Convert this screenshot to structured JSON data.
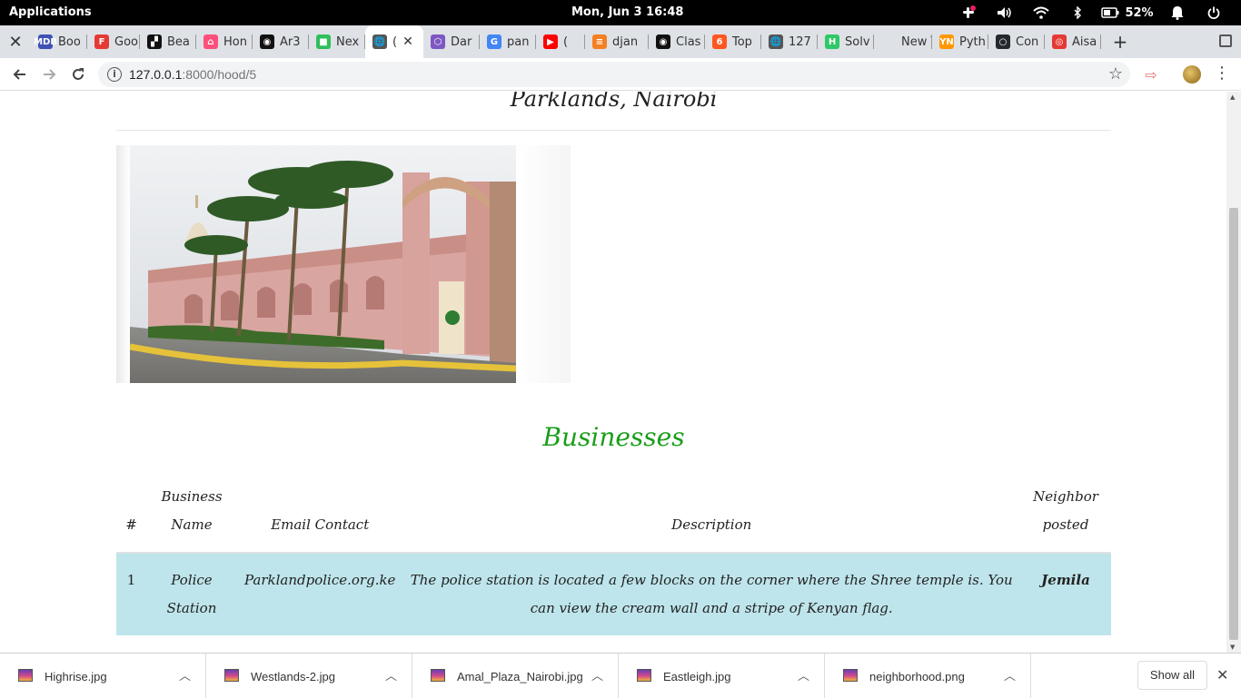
{
  "system_bar": {
    "apps_label": "Applications",
    "clock": "Mon, Jun  3   16:48",
    "battery": "52%"
  },
  "tabs": [
    {
      "label": "Boo",
      "favicon_text": "MDB",
      "favicon_color": "#3f51b5"
    },
    {
      "label": "Goo",
      "favicon_text": "F",
      "favicon_color": "#e53935"
    },
    {
      "label": "Bea",
      "favicon_text": "▞",
      "favicon_color": "#111111"
    },
    {
      "label": "Hon",
      "favicon_text": "⌂",
      "favicon_color": "#ff4f7b"
    },
    {
      "label": "Ar3",
      "favicon_text": "◉",
      "favicon_color": "#111111"
    },
    {
      "label": "Nex",
      "favicon_text": "■",
      "favicon_color": "#2fbf5b"
    },
    {
      "label": "(",
      "favicon_text": "🌐",
      "favicon_color": "#555555",
      "active": true
    },
    {
      "label": "Dar",
      "favicon_text": "⬡",
      "favicon_color": "#7e57c2"
    },
    {
      "label": "pan",
      "favicon_text": "G",
      "favicon_color": "#4285f4"
    },
    {
      "label": "(",
      "favicon_text": "▶",
      "favicon_color": "#ff0000"
    },
    {
      "label": "djan",
      "favicon_text": "≡",
      "favicon_color": "#f48024"
    },
    {
      "label": "Clas",
      "favicon_text": "◉",
      "favicon_color": "#111111"
    },
    {
      "label": "Top",
      "favicon_text": "6",
      "favicon_color": "#ff5722"
    },
    {
      "label": "127",
      "favicon_text": "🌐",
      "favicon_color": "#555555"
    },
    {
      "label": "Solv",
      "favicon_text": "H",
      "favicon_color": "#2ec866"
    },
    {
      "label": "New Tal",
      "favicon_text": "",
      "favicon_color": "transparent"
    },
    {
      "label": "Pyth",
      "favicon_text": "YN",
      "favicon_color": "#ff9800"
    },
    {
      "label": "Con",
      "favicon_text": "○",
      "favicon_color": "#24292e"
    },
    {
      "label": "Aisa",
      "favicon_text": "◎",
      "favicon_color": "#e53935"
    }
  ],
  "address": {
    "host": "127.0.0.1",
    "rest": ":8000/hood/5"
  },
  "page": {
    "hood_title": "Parklands, Nairobi",
    "section_title": "Businesses",
    "table": {
      "headers": [
        "#",
        "Business Name",
        "Email Contact",
        "Description",
        "Neighbor posted"
      ],
      "rows": [
        {
          "num": "1",
          "name": "Police Station",
          "email": "Parklandpolice.org.ke",
          "description": "The police station is located a few blocks on the corner where the Shree temple is. You can view the cream wall and a stripe of Kenyan flag.",
          "neighbor": "Jemila"
        }
      ]
    }
  },
  "downloads": [
    {
      "name": "Highrise.jpg"
    },
    {
      "name": "Westlands-2.jpg"
    },
    {
      "name": "Amal_Plaza_Nairobi.jpg"
    },
    {
      "name": "Eastleigh.jpg"
    },
    {
      "name": "neighborhood.png"
    }
  ],
  "downloads_show_all": "Show all",
  "colors": {
    "section_title": "#1a9e1a",
    "row_highlight": "#bee5eb"
  }
}
